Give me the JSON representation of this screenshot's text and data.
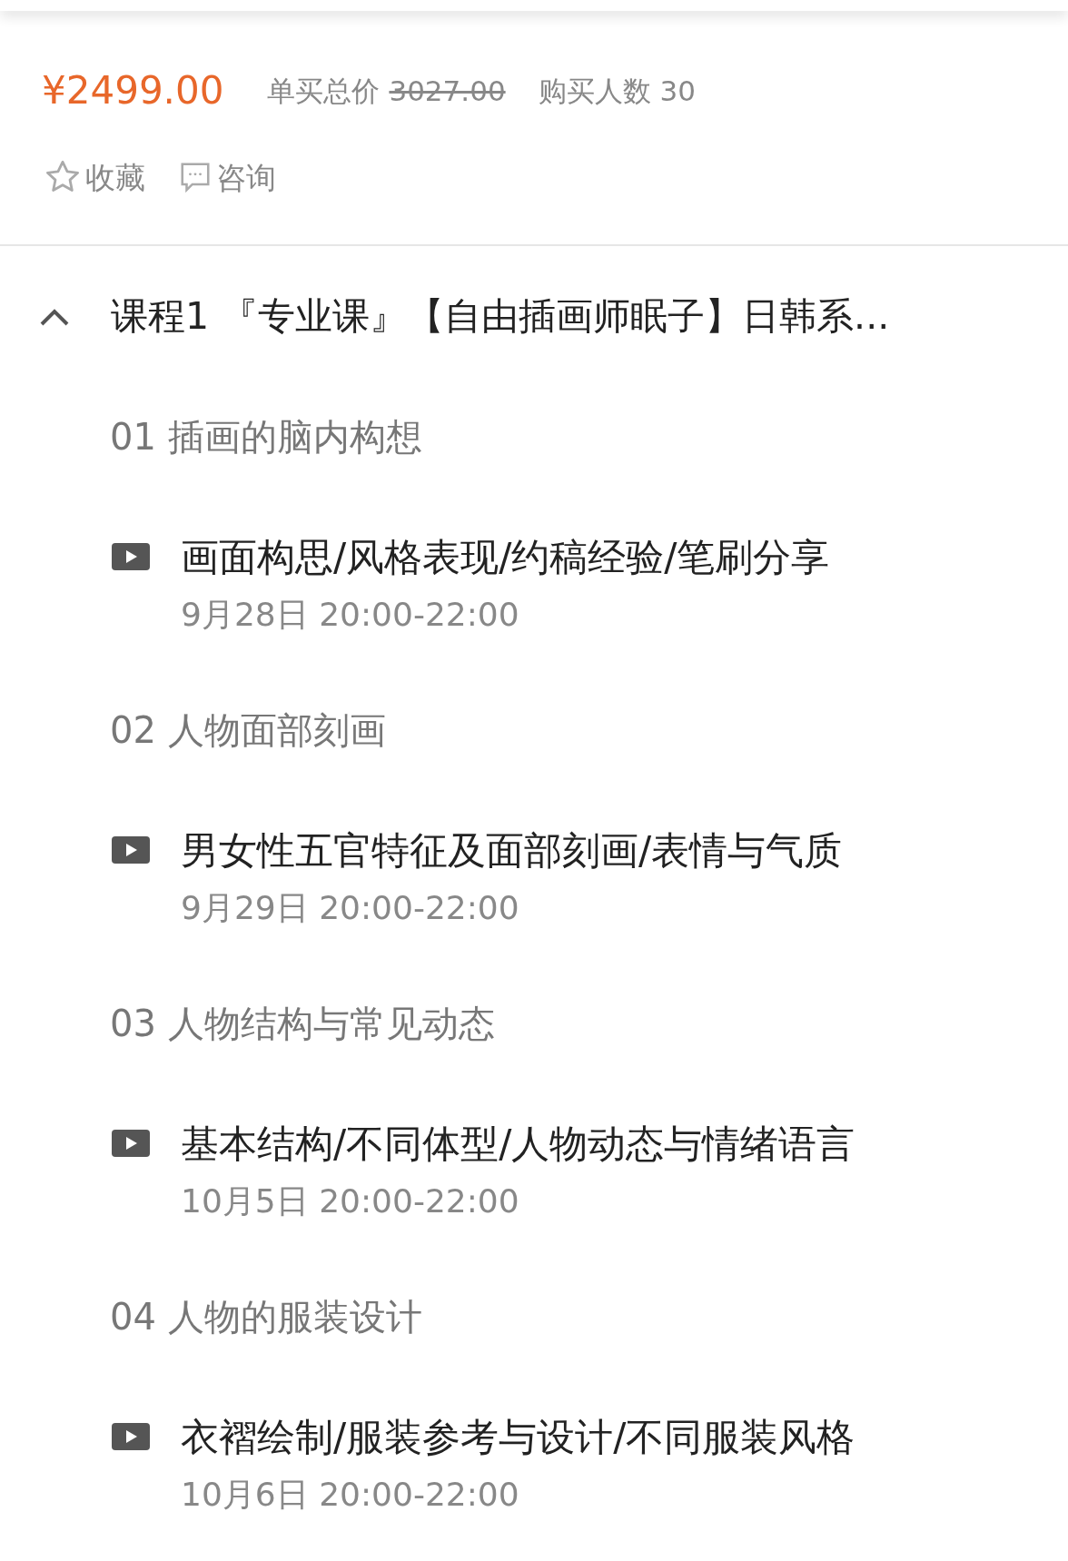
{
  "price": {
    "current": "¥2499.00",
    "original_label": "单买总价",
    "original": "3027.00",
    "buyers": "购买人数 30"
  },
  "actions": [
    {
      "kind": "favorite",
      "label": "收藏"
    },
    {
      "kind": "consult",
      "label": "咨询"
    }
  ],
  "course": {
    "title": "课程1 『专业课』【自由插画师眠子】日韩系...",
    "expanded": true,
    "sections": [
      {
        "title": "01 插画的脑内构想",
        "lessons": [
          {
            "title": "画面构思/风格表现/约稿经验/笔刷分享",
            "time": "9月28日 20:00-22:00"
          }
        ]
      },
      {
        "title": "02 人物面部刻画",
        "lessons": [
          {
            "title": "男女性五官特征及面部刻画/表情与气质",
            "time": "9月29日 20:00-22:00"
          }
        ]
      },
      {
        "title": "03 人物结构与常见动态",
        "lessons": [
          {
            "title": "基本结构/不同体型/人物动态与情绪语言",
            "time": "10月5日 20:00-22:00"
          }
        ]
      },
      {
        "title": "04 人物的服装设计",
        "lessons": [
          {
            "title": "衣褶绘制/服装参考与设计/不同服装风格",
            "time": "10月6日 20:00-22:00"
          }
        ]
      }
    ]
  }
}
